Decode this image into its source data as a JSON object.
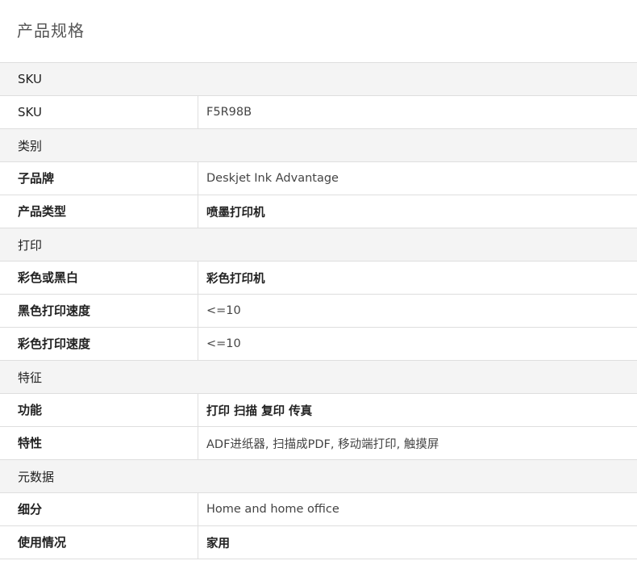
{
  "page": {
    "title": "产品规格"
  },
  "specs": {
    "sku_section": "SKU",
    "sku_label": "SKU",
    "sku_value": "F5R98B",
    "category_section": "类别",
    "sub_brand_label": "子品牌",
    "sub_brand_value": "Deskjet Ink Advantage",
    "product_type_label": "产品类型",
    "product_type_value": "喷墨打印机",
    "print_section": "打印",
    "color_mode_label": "彩色或黑白",
    "color_mode_value": "彩色打印机",
    "black_speed_label": "黑色打印速度",
    "black_speed_value": "<=10",
    "color_speed_label": "彩色打印速度",
    "color_speed_value": "<=10",
    "features_section": "特征",
    "functions_label": "功能",
    "functions_value": "打印 扫描 复印 传真",
    "characteristics_label": "特性",
    "characteristics_value": "ADF进纸器, 扫描成PDF, 移动端打印, 触摸屏",
    "metadata_section": "元数据",
    "segment_label": "细分",
    "segment_value": "Home and home office",
    "usage_label": "使用情况",
    "usage_value": "家用"
  }
}
